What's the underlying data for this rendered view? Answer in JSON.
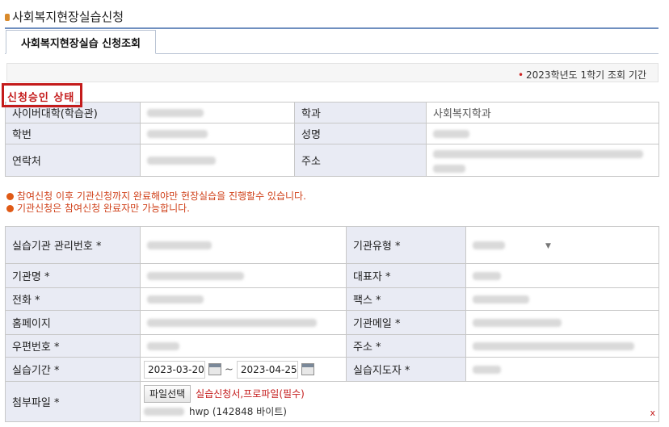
{
  "page": {
    "title": "사회복지현장실습신청"
  },
  "tabs": [
    {
      "label": "사회복지현장실습 신청조회",
      "active": true
    }
  ],
  "period": {
    "text": "2023학년도 1학기 조회 기간"
  },
  "status": {
    "label": "신청승인 상태"
  },
  "student": {
    "univ_label": "사이버대학(학습관)",
    "dept_label": "학과",
    "dept_value": "사회복지학과",
    "id_label": "학번",
    "name_label": "성명",
    "phone_label": "연락처",
    "address_label": "주소"
  },
  "notices": [
    "참여신청 이후 기관신청까지 완료해야만 현장실습을 진행할수 있습니다.",
    "기관신청은 참여신청 완료자만 가능합니다."
  ],
  "institution": {
    "mgmt_no_label": "실습기관 관리번호 *",
    "type_label": "기관유형 *",
    "name_label": "기관명 *",
    "rep_label": "대표자 *",
    "tel_label": "전화 *",
    "fax_label": "팩스 *",
    "homepage_label": "홈페이지",
    "email_label": "기관메일 *",
    "zip_label": "우편번호 *",
    "address_label": "주소 *",
    "period_label": "실습기간 *",
    "period_start": "2023-03-20",
    "period_sep": "~",
    "period_end": "2023-04-25",
    "supervisor_label": "실습지도자 *",
    "attach_label": "첨부파일 *",
    "file_button": "파일선택",
    "file_note": "실습신청서,프로파일(필수)",
    "file_info": "hwp (142848 바이트)",
    "remove_mark": "x"
  },
  "colors": {
    "accent_red": "#c41b1b",
    "notice_orange": "#d0421b",
    "header_bg": "#e9ebf4",
    "title_rule": "#6f8fbf"
  }
}
